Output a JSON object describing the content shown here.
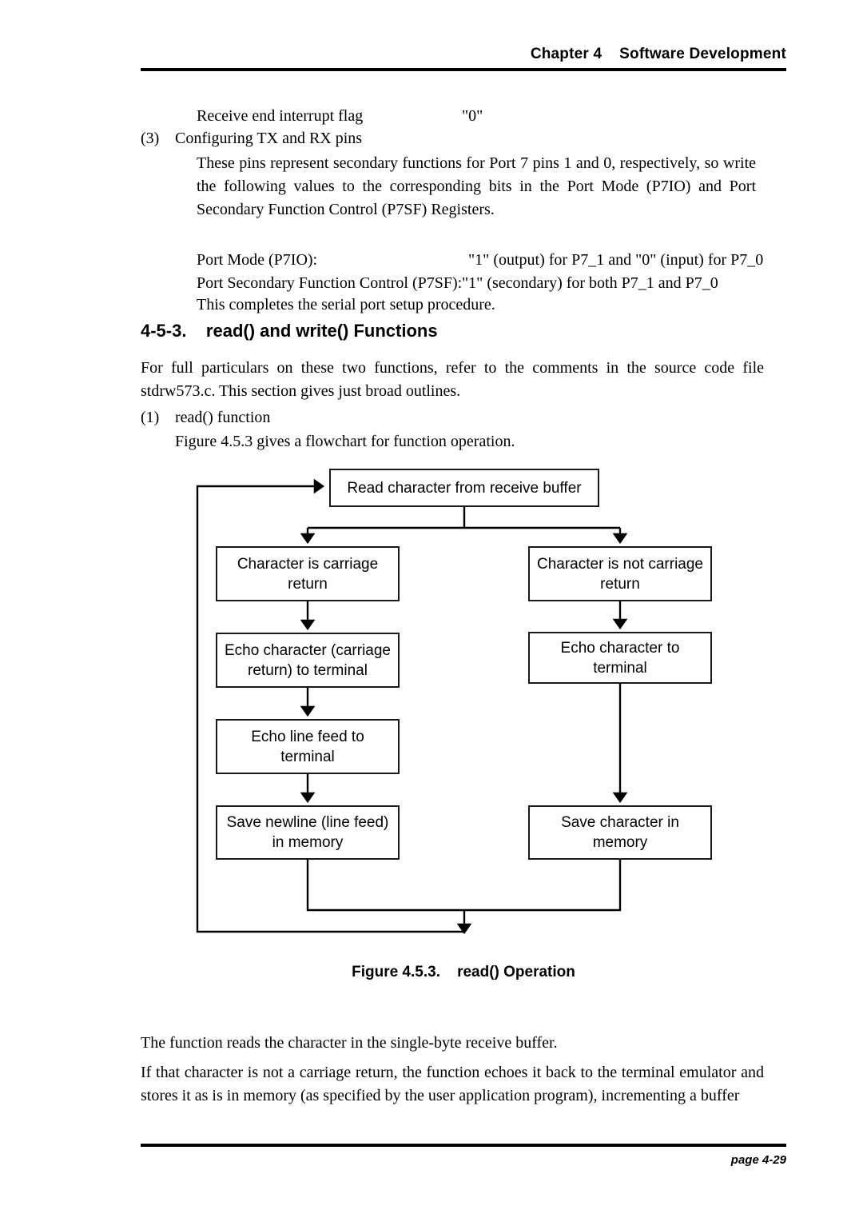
{
  "header": {
    "title": "Chapter 4    Software Development"
  },
  "footer": {
    "page_label": "page 4-29"
  },
  "body": {
    "line_receive_flag": "Receive end interrupt flag",
    "value_receive_flag": "\"0\"",
    "item3_number": "(3)",
    "item3_title": "Configuring TX and RX pins",
    "para_pins": "These pins represent secondary functions for Port 7 pins 1 and 0, respectively, so write the following values to the corresponding bits in the Port Mode (P7IO) and Port Secondary Function Control (P7SF) Registers.",
    "port_mode_label": "Port Mode (P7IO):",
    "port_mode_value": "\"1\" (output) for P7_1 and \"0\" (input) for P7_0",
    "port_sf_label": "Port Secondary Function Control (P7SF):",
    "port_sf_value": "\"1\" (secondary) for both P7_1 and P7_0",
    "completes_line": "This completes the serial port setup procedure.",
    "section_heading": "4-5-3.    read() and write() Functions",
    "para_particulars": "For full particulars on these two functions, refer to the comments in the source code file stdrw573.c. This section gives just broad outlines.",
    "item1_number": "(1)",
    "item1_title": "read() function",
    "figure_intro": "Figure 4.5.3 gives a flowchart for function operation.",
    "para_after_fig_1": "The function reads the character in the single-byte receive buffer.",
    "para_after_fig_2": "If that character is not a carriage return, the function echoes it back to the terminal emulator and stores it as is in memory (as specified by the user application program), incrementing a buffer"
  },
  "figure": {
    "caption": "Figure 4.5.3.    read() Operation",
    "nodes": {
      "read_buffer": "Read character from receive buffer",
      "is_cr": "Character is carriage return",
      "not_cr": "Character is not carriage return",
      "echo_cr": "Echo character (carriage return) to terminal",
      "echo_char": "Echo character to terminal",
      "echo_lf": "Echo line feed to terminal",
      "save_newline": "Save newline (line feed) in memory",
      "save_char": "Save character in memory"
    }
  },
  "colors": {
    "ink": "#000000",
    "box_border": "#1a1a1a",
    "paper": "#ffffff"
  }
}
